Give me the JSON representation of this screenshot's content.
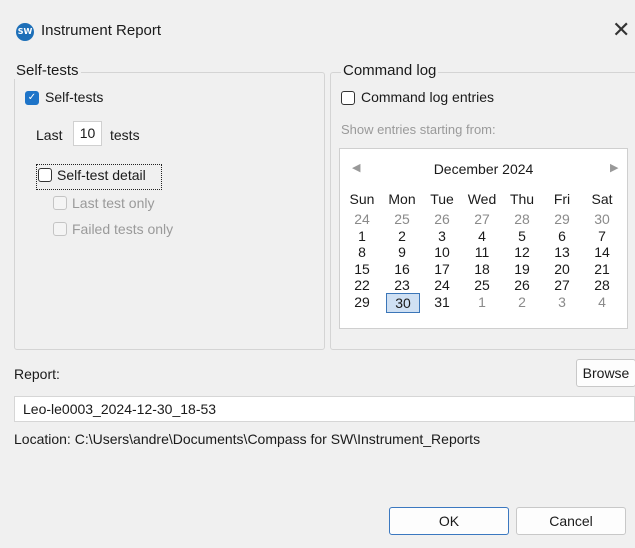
{
  "window": {
    "title": "Instrument Report",
    "app_icon_text": "SW",
    "close_glyph": "✕"
  },
  "self_tests": {
    "group_title": "Self-tests",
    "checkbox_label": "Self-tests",
    "checkbox_checked": true,
    "last_label": "Last",
    "count_value": "10",
    "tests_label": "tests",
    "detail_label": "Self-test detail",
    "detail_checked": false,
    "last_only_label": "Last test only",
    "failed_only_label": "Failed tests only"
  },
  "command_log": {
    "group_title": "Command log",
    "checkbox_label": "Command log entries",
    "checkbox_checked": false,
    "show_from_label": "Show entries starting from:"
  },
  "calendar": {
    "month_label": "December 2024",
    "prev_glyph": "◀",
    "next_glyph": "▶",
    "weekdays": [
      "Sun",
      "Mon",
      "Tue",
      "Wed",
      "Thu",
      "Fri",
      "Sat"
    ],
    "weeks": [
      [
        "24",
        "25",
        "26",
        "27",
        "28",
        "29",
        "30"
      ],
      [
        "1",
        "2",
        "3",
        "4",
        "5",
        "6",
        "7"
      ],
      [
        "8",
        "9",
        "10",
        "11",
        "12",
        "13",
        "14"
      ],
      [
        "15",
        "16",
        "17",
        "18",
        "19",
        "20",
        "21"
      ],
      [
        "22",
        "23",
        "24",
        "25",
        "26",
        "27",
        "28"
      ],
      [
        "29",
        "30",
        "31",
        "1",
        "2",
        "3",
        "4"
      ]
    ],
    "selected_day": "30"
  },
  "report": {
    "label": "Report:",
    "browse_label": "Browse",
    "filename": "Leo-le0003_2024-12-30_18-53",
    "location_text": "Location: C:\\Users\\andre\\Documents\\Compass for SW\\Instrument_Reports"
  },
  "buttons": {
    "ok_label": "OK",
    "cancel_label": "Cancel"
  },
  "colors": {
    "accent": "#1e74c8",
    "selected_day_bg": "#cfe0f3",
    "disabled_text": "#9a9a9a"
  }
}
